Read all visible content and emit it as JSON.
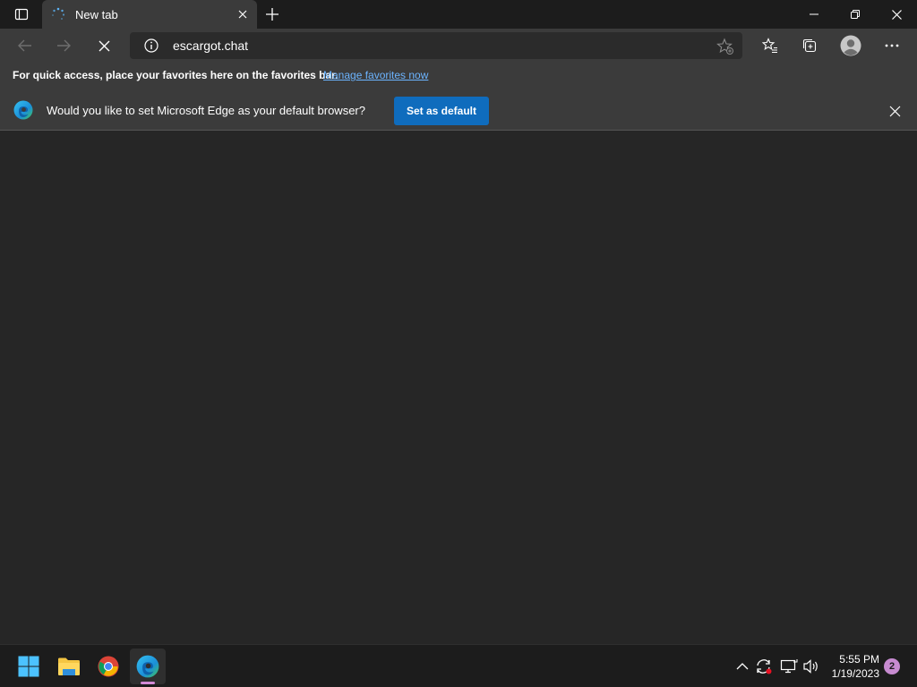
{
  "browser": {
    "tab": {
      "title": "New tab"
    },
    "address_bar": {
      "url": "escargot.chat"
    },
    "favorites_bar": {
      "message": "For quick access, place your favorites here on the favorites bar.",
      "link": "Manage favorites now"
    },
    "default_browser_prompt": {
      "message": "Would you like to set Microsoft Edge as your default browser?",
      "button": "Set as default"
    },
    "state": "loading"
  },
  "taskbar": {
    "apps": [
      "start-icon",
      "file-explorer-icon",
      "chrome-icon",
      "edge-icon"
    ],
    "active_app": "edge-icon",
    "clock": {
      "time": "5:55 PM",
      "date": "1/19/2023"
    },
    "notification_count": "2"
  },
  "colors": {
    "accent": "#0f6cbd",
    "link": "#6cb4ff",
    "background": "#262626",
    "chrome": "#3b3b3b"
  }
}
